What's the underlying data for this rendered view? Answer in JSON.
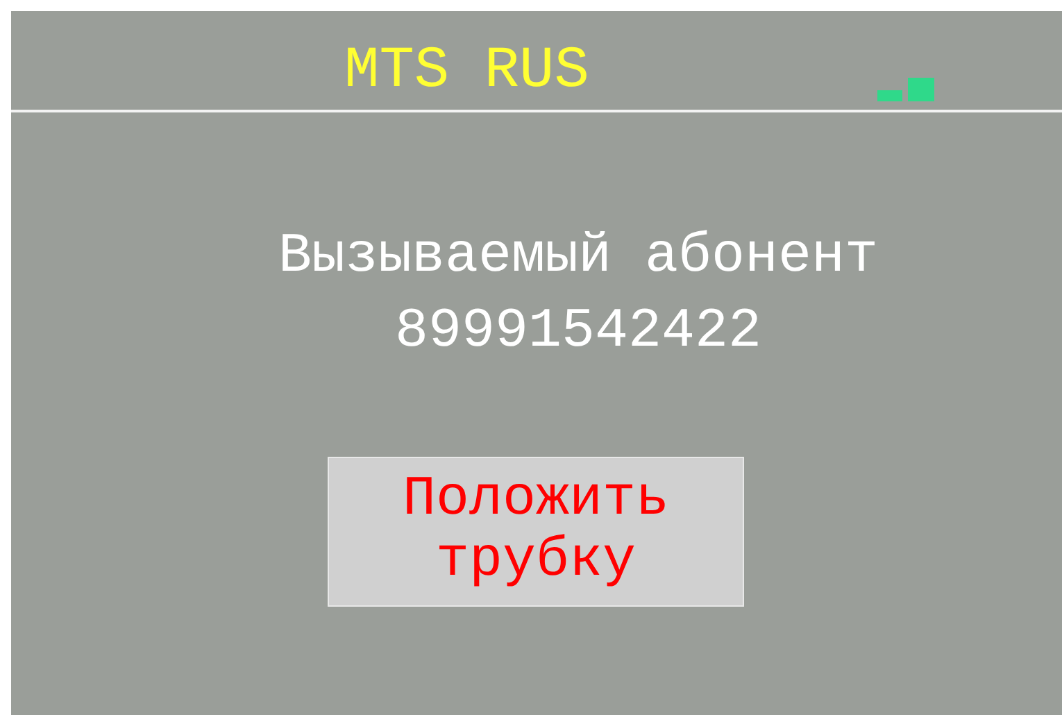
{
  "header": {
    "operator": "MTS RUS"
  },
  "message": {
    "label": "Вызываемый абонент",
    "number": "89991542422"
  },
  "buttons": [
    {
      "label": "Положить трубку",
      "kind": "hangup"
    }
  ]
}
